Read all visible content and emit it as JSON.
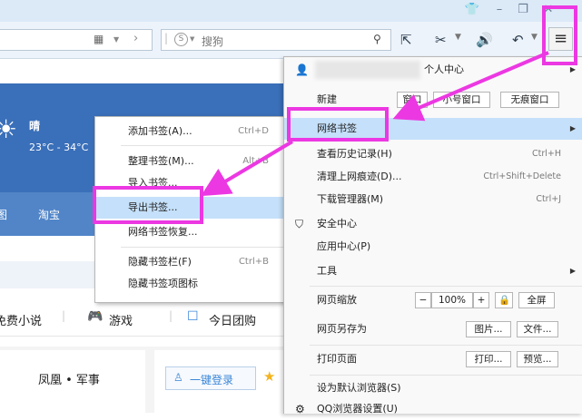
{
  "titlebar": {
    "icons": [
      "skin-icon",
      "minimize-icon",
      "restore-icon",
      "close-icon"
    ],
    "glyphs": [
      "👕",
      "–",
      "❐",
      "✕"
    ]
  },
  "toolbar": {
    "search_placeholder": "搜狗",
    "search_engine_letter": "S"
  },
  "page": {
    "weather": {
      "condition": "晴",
      "temp": "23°C - 34°C"
    },
    "nav_items": [
      "图",
      "淘宝"
    ],
    "links": [
      "免费小说",
      "游戏",
      "今日团购"
    ],
    "news": [
      "凤凰 • 军事"
    ],
    "login_label": "一键登录"
  },
  "bookmark_menu": {
    "items": [
      {
        "label": "添加书签(A)...",
        "shortcut": "Ctrl+D"
      },
      {
        "label": "整理书签(M)...",
        "shortcut": "Alt+B"
      },
      {
        "label": "导入书签...",
        "shortcut": ""
      },
      {
        "label": "导出书签...",
        "shortcut": ""
      },
      {
        "label": "网络书签恢复...",
        "shortcut": ""
      },
      {
        "label": "隐藏书签栏(F)",
        "shortcut": "Ctrl+B"
      },
      {
        "label": "隐藏书签项图标",
        "shortcut": ""
      }
    ]
  },
  "main_menu": {
    "user_label": "个人中心",
    "new_label": "新建",
    "new_buttons": [
      "窗口",
      "小号窗口",
      "无痕窗口"
    ],
    "items": [
      {
        "label": "网络书签",
        "shortcut": ""
      },
      {
        "label": "查看历史记录(H)",
        "shortcut": "Ctrl+H"
      },
      {
        "label": "清理上网痕迹(D)...",
        "shortcut": "Ctrl+Shift+Delete"
      },
      {
        "label": "下载管理器(M)",
        "shortcut": "Ctrl+J"
      },
      {
        "label": "安全中心",
        "shortcut": ""
      },
      {
        "label": "应用中心(P)",
        "shortcut": ""
      },
      {
        "label": "工具",
        "shortcut": ""
      }
    ],
    "zoom_label": "网页缩放",
    "zoom_minus": "−",
    "zoom_value": "100%",
    "zoom_plus": "+",
    "fullscreen": "全屏",
    "saveas_label": "网页另存为",
    "saveas_buttons": [
      "图片...",
      "文件..."
    ],
    "print_label": "打印页面",
    "print_buttons": [
      "打印...",
      "预览..."
    ],
    "default_label": "设为默认浏览器(S)",
    "settings_label": "QQ浏览器设置(U)"
  },
  "colors": {
    "highlight": "#c5e0fa",
    "annotation": "#ec38e2"
  }
}
